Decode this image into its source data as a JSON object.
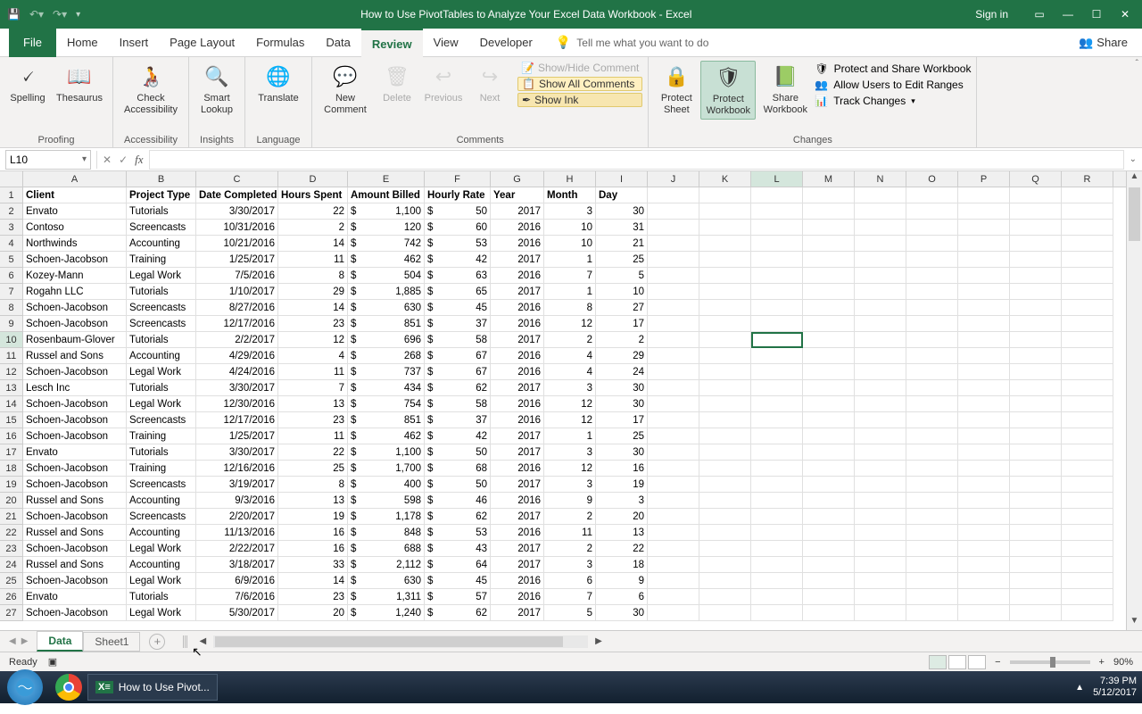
{
  "title": "How to Use PivotTables to Analyze Your Excel Data Workbook  -  Excel",
  "signin": "Sign in",
  "tabs": {
    "file": "File",
    "items": [
      "Home",
      "Insert",
      "Page Layout",
      "Formulas",
      "Data",
      "Review",
      "View",
      "Developer"
    ],
    "active": "Review",
    "tell_me_placeholder": "Tell me what you want to do",
    "share": "Share"
  },
  "ribbon": {
    "proofing": {
      "label": "Proofing",
      "spelling": "Spelling",
      "thesaurus": "Thesaurus"
    },
    "accessibility": {
      "label": "Accessibility",
      "check": "Check Accessibility"
    },
    "insights": {
      "label": "Insights",
      "smart": "Smart Lookup"
    },
    "language": {
      "label": "Language",
      "translate": "Translate"
    },
    "comments": {
      "label": "Comments",
      "new": "New Comment",
      "delete": "Delete",
      "previous": "Previous",
      "next": "Next",
      "show_hide": "Show/Hide Comment",
      "show_all": "Show All Comments",
      "show_ink": "Show Ink"
    },
    "changes": {
      "label": "Changes",
      "protect_sheet": "Protect Sheet",
      "protect_wb": "Protect Workbook",
      "share_wb": "Share Workbook",
      "protect_share": "Protect and Share Workbook",
      "allow_edit": "Allow Users to Edit Ranges",
      "track": "Track Changes"
    }
  },
  "namebox": "L10",
  "columns": [
    "A",
    "B",
    "C",
    "D",
    "E",
    "F",
    "G",
    "H",
    "I",
    "J",
    "K",
    "L",
    "M",
    "N",
    "O",
    "P",
    "Q",
    "R"
  ],
  "colClasses": [
    "cA",
    "cB",
    "cC",
    "cD",
    "cE",
    "cF",
    "cG",
    "cH",
    "cI",
    "cJ",
    "cK",
    "cL",
    "cM",
    "cN",
    "cO",
    "cP",
    "cQ",
    "cR"
  ],
  "selectedCol": "L",
  "selectedRow": 10,
  "headers": [
    "Client",
    "Project Type",
    "Date Completed",
    "Hours Spent",
    "Amount Billed",
    "Hourly Rate",
    "Year",
    "Month",
    "Day"
  ],
  "rows": [
    {
      "client": "Envato",
      "type": "Tutorials",
      "date": "3/30/2017",
      "hours": 22,
      "amount": "1,100",
      "rate": 50,
      "year": 2017,
      "month": 3,
      "day": 30
    },
    {
      "client": "Contoso",
      "type": "Screencasts",
      "date": "10/31/2016",
      "hours": 2,
      "amount": "120",
      "rate": 60,
      "year": 2016,
      "month": 10,
      "day": 31
    },
    {
      "client": "Northwinds",
      "type": "Accounting",
      "date": "10/21/2016",
      "hours": 14,
      "amount": "742",
      "rate": 53,
      "year": 2016,
      "month": 10,
      "day": 21
    },
    {
      "client": "Schoen-Jacobson",
      "type": "Training",
      "date": "1/25/2017",
      "hours": 11,
      "amount": "462",
      "rate": 42,
      "year": 2017,
      "month": 1,
      "day": 25
    },
    {
      "client": "Kozey-Mann",
      "type": "Legal Work",
      "date": "7/5/2016",
      "hours": 8,
      "amount": "504",
      "rate": 63,
      "year": 2016,
      "month": 7,
      "day": 5
    },
    {
      "client": "Rogahn LLC",
      "type": "Tutorials",
      "date": "1/10/2017",
      "hours": 29,
      "amount": "1,885",
      "rate": 65,
      "year": 2017,
      "month": 1,
      "day": 10
    },
    {
      "client": "Schoen-Jacobson",
      "type": "Screencasts",
      "date": "8/27/2016",
      "hours": 14,
      "amount": "630",
      "rate": 45,
      "year": 2016,
      "month": 8,
      "day": 27
    },
    {
      "client": "Schoen-Jacobson",
      "type": "Screencasts",
      "date": "12/17/2016",
      "hours": 23,
      "amount": "851",
      "rate": 37,
      "year": 2016,
      "month": 12,
      "day": 17
    },
    {
      "client": "Rosenbaum-Glover",
      "type": "Tutorials",
      "date": "2/2/2017",
      "hours": 12,
      "amount": "696",
      "rate": 58,
      "year": 2017,
      "month": 2,
      "day": 2
    },
    {
      "client": "Russel and Sons",
      "type": "Accounting",
      "date": "4/29/2016",
      "hours": 4,
      "amount": "268",
      "rate": 67,
      "year": 2016,
      "month": 4,
      "day": 29
    },
    {
      "client": "Schoen-Jacobson",
      "type": "Legal Work",
      "date": "4/24/2016",
      "hours": 11,
      "amount": "737",
      "rate": 67,
      "year": 2016,
      "month": 4,
      "day": 24
    },
    {
      "client": "Lesch Inc",
      "type": "Tutorials",
      "date": "3/30/2017",
      "hours": 7,
      "amount": "434",
      "rate": 62,
      "year": 2017,
      "month": 3,
      "day": 30
    },
    {
      "client": "Schoen-Jacobson",
      "type": "Legal Work",
      "date": "12/30/2016",
      "hours": 13,
      "amount": "754",
      "rate": 58,
      "year": 2016,
      "month": 12,
      "day": 30
    },
    {
      "client": "Schoen-Jacobson",
      "type": "Screencasts",
      "date": "12/17/2016",
      "hours": 23,
      "amount": "851",
      "rate": 37,
      "year": 2016,
      "month": 12,
      "day": 17
    },
    {
      "client": "Schoen-Jacobson",
      "type": "Training",
      "date": "1/25/2017",
      "hours": 11,
      "amount": "462",
      "rate": 42,
      "year": 2017,
      "month": 1,
      "day": 25
    },
    {
      "client": "Envato",
      "type": "Tutorials",
      "date": "3/30/2017",
      "hours": 22,
      "amount": "1,100",
      "rate": 50,
      "year": 2017,
      "month": 3,
      "day": 30
    },
    {
      "client": "Schoen-Jacobson",
      "type": "Training",
      "date": "12/16/2016",
      "hours": 25,
      "amount": "1,700",
      "rate": 68,
      "year": 2016,
      "month": 12,
      "day": 16
    },
    {
      "client": "Schoen-Jacobson",
      "type": "Screencasts",
      "date": "3/19/2017",
      "hours": 8,
      "amount": "400",
      "rate": 50,
      "year": 2017,
      "month": 3,
      "day": 19
    },
    {
      "client": "Russel and Sons",
      "type": "Accounting",
      "date": "9/3/2016",
      "hours": 13,
      "amount": "598",
      "rate": 46,
      "year": 2016,
      "month": 9,
      "day": 3
    },
    {
      "client": "Schoen-Jacobson",
      "type": "Screencasts",
      "date": "2/20/2017",
      "hours": 19,
      "amount": "1,178",
      "rate": 62,
      "year": 2017,
      "month": 2,
      "day": 20
    },
    {
      "client": "Russel and Sons",
      "type": "Accounting",
      "date": "11/13/2016",
      "hours": 16,
      "amount": "848",
      "rate": 53,
      "year": 2016,
      "month": 11,
      "day": 13
    },
    {
      "client": "Schoen-Jacobson",
      "type": "Legal Work",
      "date": "2/22/2017",
      "hours": 16,
      "amount": "688",
      "rate": 43,
      "year": 2017,
      "month": 2,
      "day": 22
    },
    {
      "client": "Russel and Sons",
      "type": "Accounting",
      "date": "3/18/2017",
      "hours": 33,
      "amount": "2,112",
      "rate": 64,
      "year": 2017,
      "month": 3,
      "day": 18
    },
    {
      "client": "Schoen-Jacobson",
      "type": "Legal Work",
      "date": "6/9/2016",
      "hours": 14,
      "amount": "630",
      "rate": 45,
      "year": 2016,
      "month": 6,
      "day": 9
    },
    {
      "client": "Envato",
      "type": "Tutorials",
      "date": "7/6/2016",
      "hours": 23,
      "amount": "1,311",
      "rate": 57,
      "year": 2016,
      "month": 7,
      "day": 6
    },
    {
      "client": "Schoen-Jacobson",
      "type": "Legal Work",
      "date": "5/30/2017",
      "hours": 20,
      "amount": "1,240",
      "rate": 62,
      "year": 2017,
      "month": 5,
      "day": 30
    }
  ],
  "sheets": {
    "active": "Data",
    "other": "Sheet1"
  },
  "status": {
    "ready": "Ready",
    "zoom": "90%"
  },
  "taskbar": {
    "task": "How to Use Pivot...",
    "time": "7:39 PM",
    "date": "5/12/2017"
  }
}
